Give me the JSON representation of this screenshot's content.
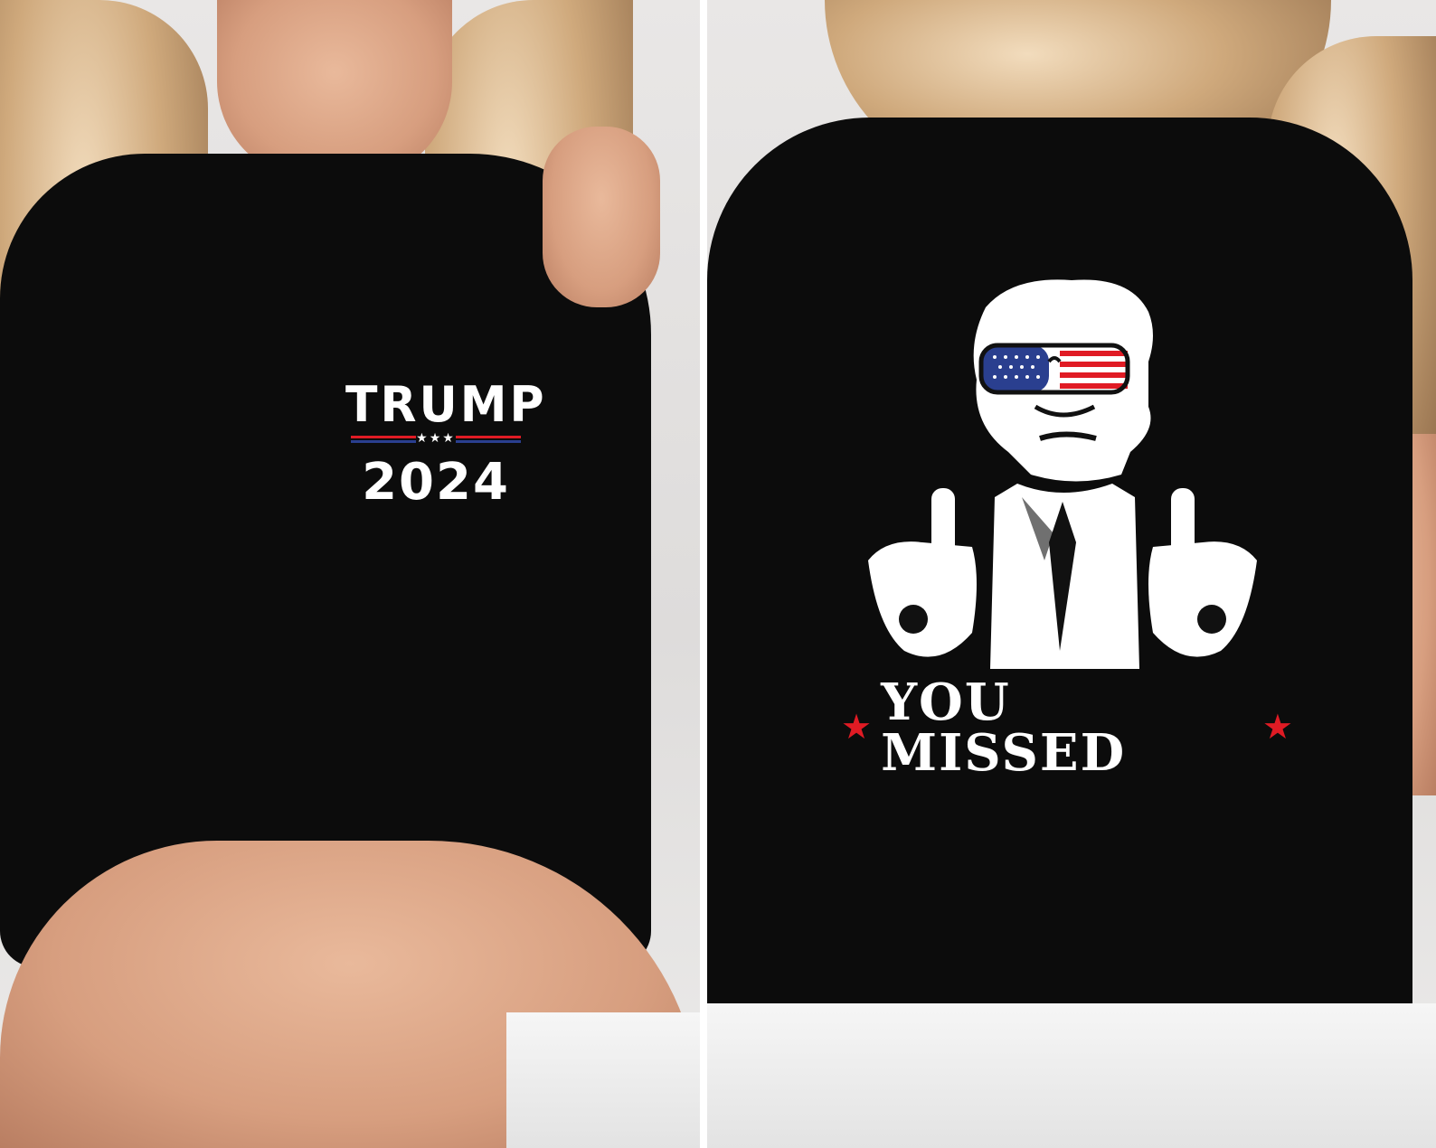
{
  "front": {
    "print_line1": "TRUMP",
    "print_line2": "2024",
    "rule_stars": "★★★"
  },
  "back": {
    "slogan": "YOU MISSED",
    "star_glyph": "★"
  },
  "colors": {
    "shirt": "#0c0c0c",
    "print_white": "#ffffff",
    "accent_red": "#e01b24",
    "accent_blue": "#2a3f8f"
  }
}
